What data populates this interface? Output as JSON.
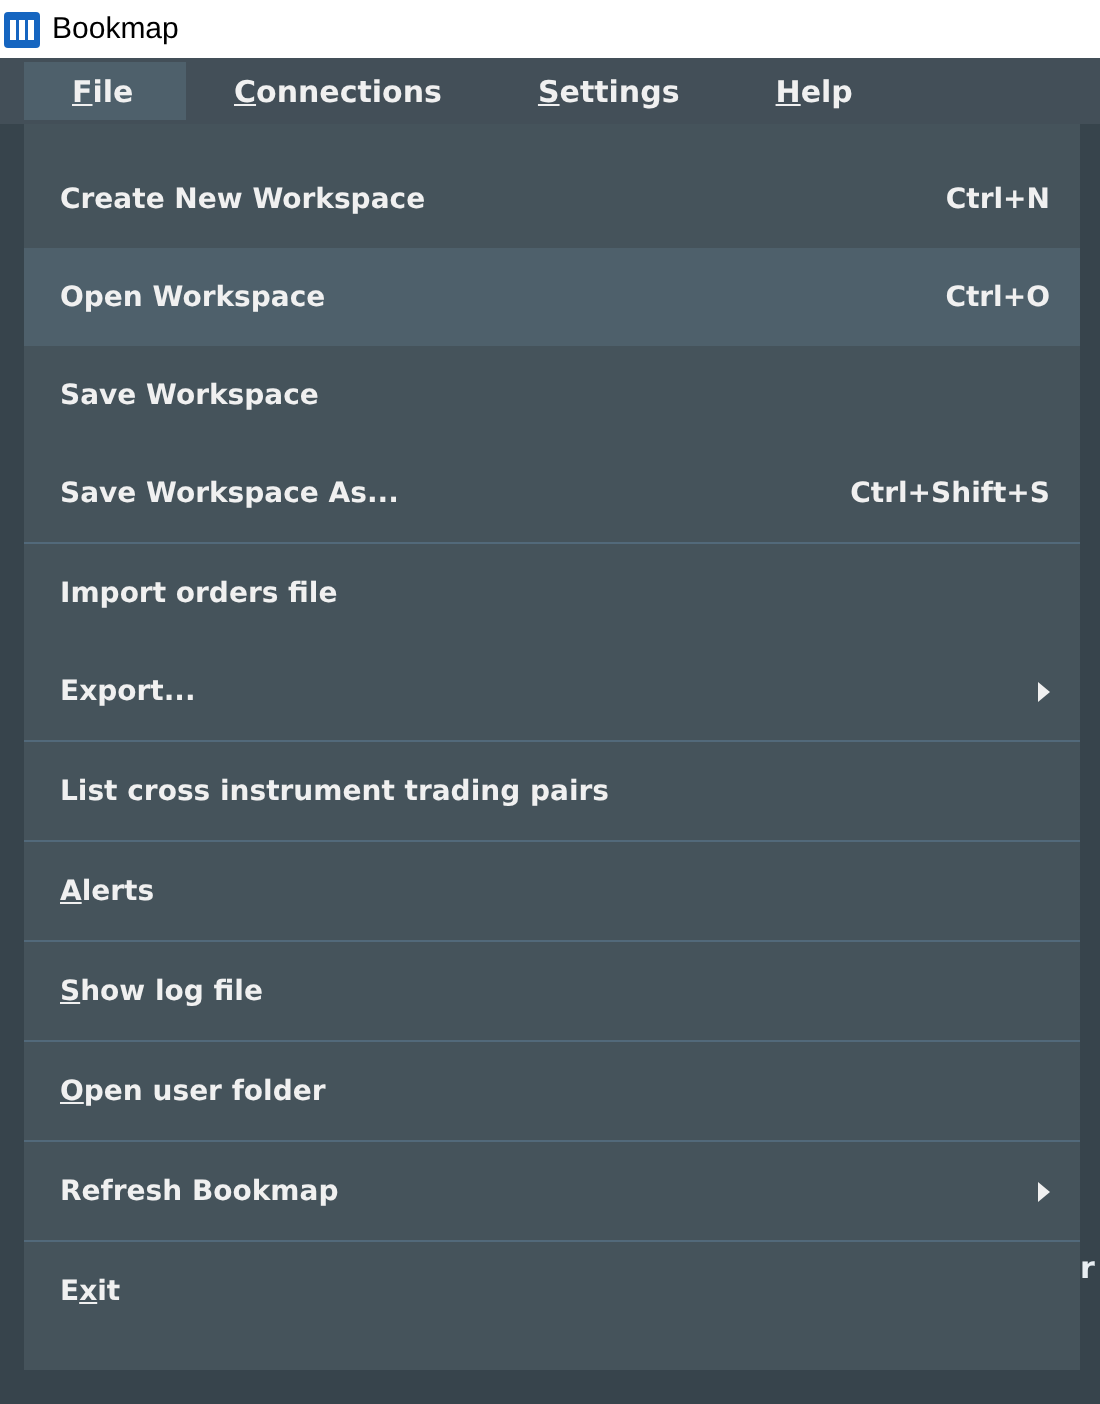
{
  "window": {
    "title": "Bookmap"
  },
  "menu_bar": [
    {
      "key": "F",
      "post": "ile",
      "selected": true
    },
    {
      "key": "C",
      "post": "onnections",
      "selected": false
    },
    {
      "key": "S",
      "post": "ettings",
      "selected": false
    },
    {
      "key": "H",
      "post": "elp",
      "selected": false
    }
  ],
  "file_menu": [
    {
      "items": [
        {
          "pre": "Create New Workspace",
          "shortcut": "Ctrl+N",
          "selected": false,
          "submenu": false
        },
        {
          "pre": "Open Workspace",
          "shortcut": "Ctrl+O",
          "selected": true,
          "submenu": false
        },
        {
          "pre": "Save Workspace",
          "selected": false,
          "submenu": false
        },
        {
          "pre": "Save Workspace As...",
          "shortcut": "Ctrl+Shift+S",
          "selected": false,
          "submenu": false
        }
      ]
    },
    {
      "items": [
        {
          "pre": "Import orders file",
          "selected": false,
          "submenu": false
        },
        {
          "pre": "Export...",
          "selected": false,
          "submenu": true
        }
      ]
    },
    {
      "items": [
        {
          "pre": "List cross instrument trading pairs",
          "selected": false,
          "submenu": false
        }
      ]
    },
    {
      "items": [
        {
          "key": "A",
          "post": "lerts",
          "selected": false,
          "submenu": false
        }
      ]
    },
    {
      "items": [
        {
          "key": "S",
          "post": "how log file",
          "selected": false,
          "submenu": false
        }
      ]
    },
    {
      "items": [
        {
          "key": "O",
          "post": "pen user folder",
          "selected": false,
          "submenu": false
        }
      ]
    },
    {
      "items": [
        {
          "pre": "Refresh Bookmap",
          "selected": false,
          "submenu": true
        }
      ]
    },
    {
      "items": [
        {
          "pre": "E",
          "key": "x",
          "post": "it",
          "selected": false,
          "submenu": false
        }
      ]
    }
  ],
  "background_text": "r"
}
